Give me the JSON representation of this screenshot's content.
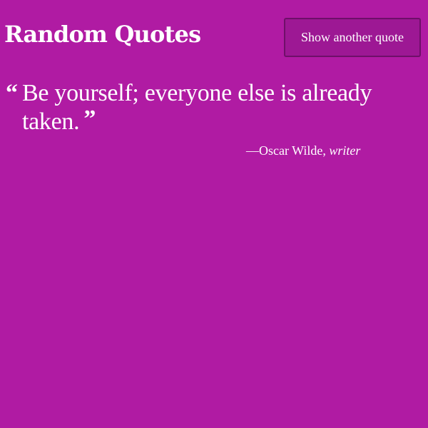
{
  "header": {
    "title": "Random Quotes",
    "button_label": "Show another quote"
  },
  "quote": {
    "open_mark": "“",
    "text": "Be yourself; everyone else is already taken.",
    "close_mark": "”",
    "dash": "—",
    "author": "Oscar Wilde",
    "separator": ", ",
    "role": "writer"
  },
  "colors": {
    "background": "#b01ba3",
    "button_background": "#9d1894",
    "button_border": "#6f0f69",
    "text": "#ffffff"
  }
}
